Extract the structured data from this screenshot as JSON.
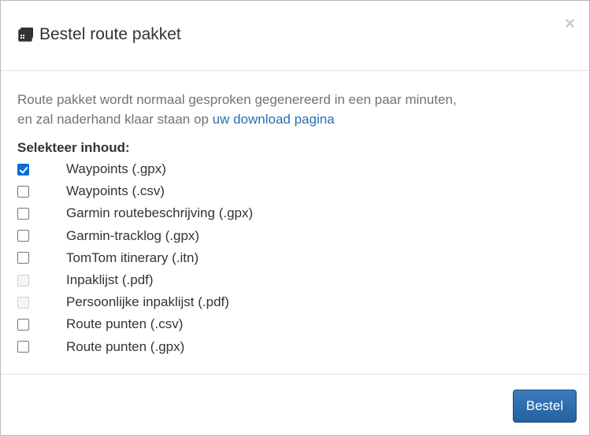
{
  "modal": {
    "title": "Bestel route pakket",
    "title_icon": "boxes-icon",
    "close_label": "×"
  },
  "body": {
    "intro_line1": "Route pakket wordt normaal gesproken gegenereerd in een paar minuten,",
    "intro_line2_prefix": "en zal naderhand klaar staan op ",
    "intro_link": "uw download pagina",
    "section_label": "Selekteer inhoud:",
    "options": [
      {
        "label": "Waypoints (.gpx)",
        "checked": true,
        "disabled": false
      },
      {
        "label": "Waypoints (.csv)",
        "checked": false,
        "disabled": false
      },
      {
        "label": "Garmin routebeschrijving (.gpx)",
        "checked": false,
        "disabled": false
      },
      {
        "label": "Garmin-tracklog (.gpx)",
        "checked": false,
        "disabled": false
      },
      {
        "label": "TomTom itinerary (.itn)",
        "checked": false,
        "disabled": false
      },
      {
        "label": "Inpaklijst (.pdf)",
        "checked": false,
        "disabled": true
      },
      {
        "label": "Persoonlijke inpaklijst (.pdf)",
        "checked": false,
        "disabled": true
      },
      {
        "label": "Route punten (.csv)",
        "checked": false,
        "disabled": false
      },
      {
        "label": "Route punten (.gpx)",
        "checked": false,
        "disabled": false
      }
    ]
  },
  "footer": {
    "submit_label": "Bestel"
  },
  "colors": {
    "accent": "#2a6eb3",
    "button": "#2462a0",
    "checkbox_checked": "#0b6cdb"
  }
}
